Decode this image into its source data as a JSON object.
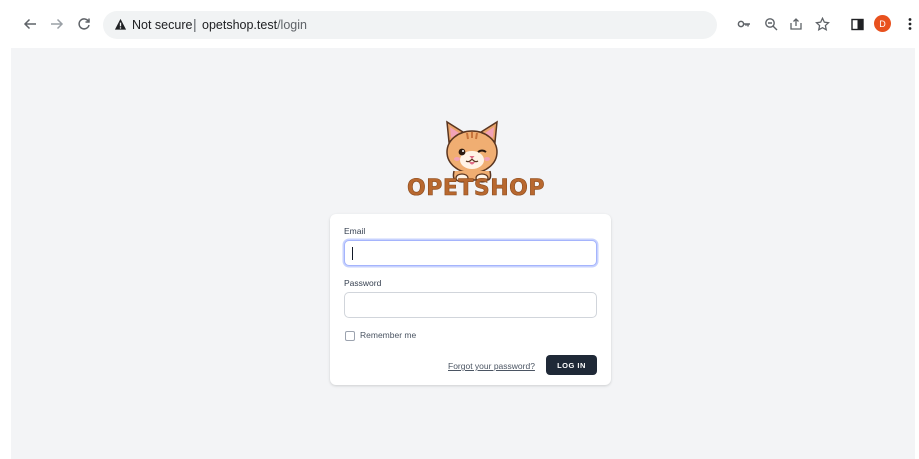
{
  "browser": {
    "security_label": "Not secure",
    "separator": "|",
    "url_host": "opetshop.test",
    "url_path": "/login",
    "avatar_letter": "D",
    "icons": [
      "back-arrow-icon",
      "forward-arrow-icon",
      "reload-icon",
      "warning-icon",
      "key-icon",
      "zoom-icon",
      "share-icon",
      "star-icon",
      "side-panel-icon",
      "avatar",
      "more-menu-icon"
    ]
  },
  "brand": {
    "name": "OPETSHOP",
    "color": "#b8682f"
  },
  "form": {
    "email_label": "Email",
    "email_value": "",
    "password_label": "Password",
    "password_value": "",
    "remember_label": "Remember me",
    "remember_checked": false,
    "forgot_link": "Forgot your password?",
    "login_button": "LOG IN"
  },
  "colors": {
    "page_bg": "#f3f4f6",
    "button_bg": "#1f2937",
    "focus_ring": "#a5b4fc",
    "avatar_bg": "#e8511e"
  }
}
